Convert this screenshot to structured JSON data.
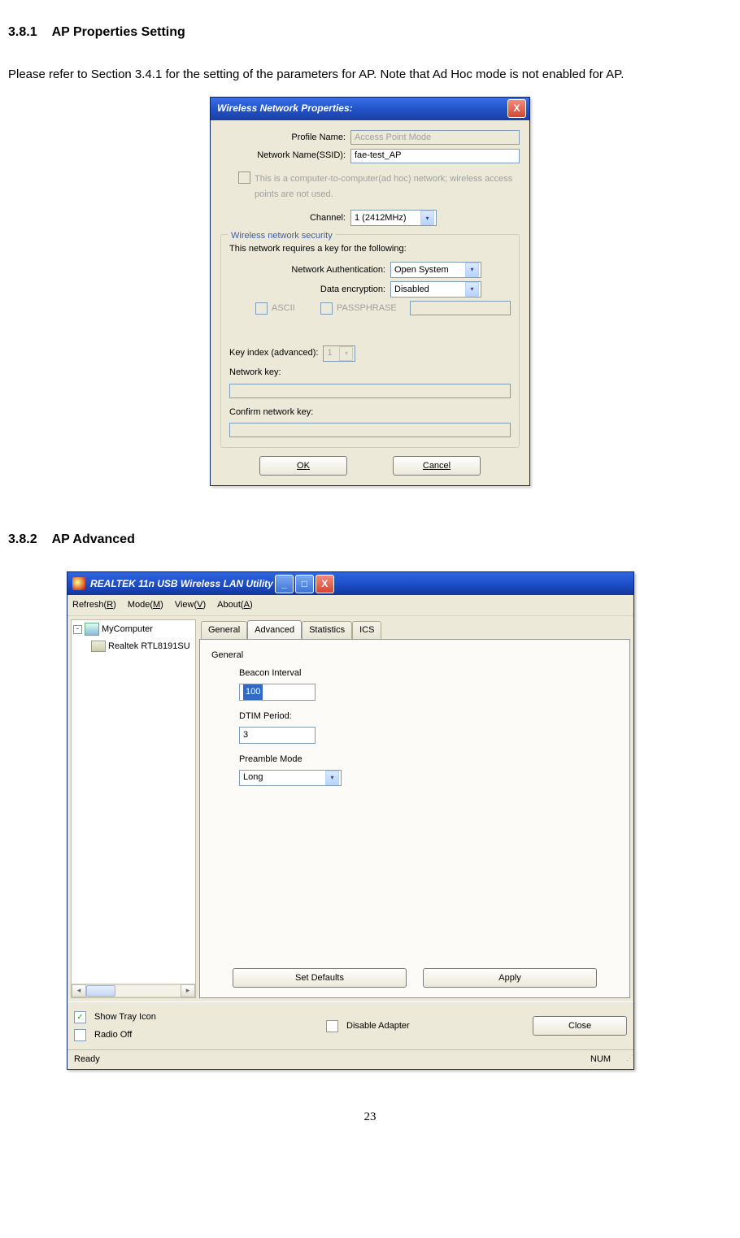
{
  "doc": {
    "h1_num": "3.8.1",
    "h1_title": "AP Properties Setting",
    "para1": "Please refer to Section 3.4.1 for the setting of the parameters for AP. Note that Ad Hoc mode is not enabled for AP.",
    "h2_num": "3.8.2",
    "h2_title": "AP Advanced",
    "page_number": "23"
  },
  "dialog1": {
    "title": "Wireless Network Properties:",
    "close": "X",
    "profile_name_label": "Profile Name:",
    "profile_name_value": "Access Point Mode",
    "ssid_label": "Network Name(SSID):",
    "ssid_value": "fae-test_AP",
    "adhoc_text": "This is a computer-to-computer(ad hoc) network; wireless access points are not used.",
    "channel_label": "Channel:",
    "channel_value": "1 (2412MHz)",
    "security_legend": "Wireless network security",
    "security_intro": "This network requires a key for the following:",
    "auth_label": "Network Authentication:",
    "auth_value": "Open System",
    "enc_label": "Data encryption:",
    "enc_value": "Disabled",
    "ascii": "ASCII",
    "passphrase": "PASSPHRASE",
    "keyindex_label": "Key index (advanced):",
    "keyindex_value": "1",
    "netkey_label": "Network key:",
    "confirm_label": "Confirm network key:",
    "ok": "OK",
    "cancel": "Cancel"
  },
  "app": {
    "title": "REALTEK 11n USB Wireless LAN Utility",
    "menu": {
      "refresh": "Refresh(R)",
      "mode": "Mode(M)",
      "view": "View(V)",
      "about": "About(A)"
    },
    "tree": {
      "root": "MyComputer",
      "child": "Realtek RTL8191SU"
    },
    "tabs": {
      "general": "General",
      "advanced": "Advanced",
      "statistics": "Statistics",
      "ics": "ICS"
    },
    "advanced": {
      "group": "General",
      "beacon_label": "Beacon Interval",
      "beacon_value": "100",
      "dtim_label": "DTIM Period:",
      "dtim_value": "3",
      "preamble_label": "Preamble Mode",
      "preamble_value": "Long",
      "set_defaults": "Set Defaults",
      "apply": "Apply"
    },
    "footer": {
      "show_tray": "Show Tray Icon",
      "radio_off": "Radio Off",
      "disable_adapter": "Disable Adapter",
      "close": "Close"
    },
    "status": {
      "ready": "Ready",
      "num": "NUM"
    }
  }
}
